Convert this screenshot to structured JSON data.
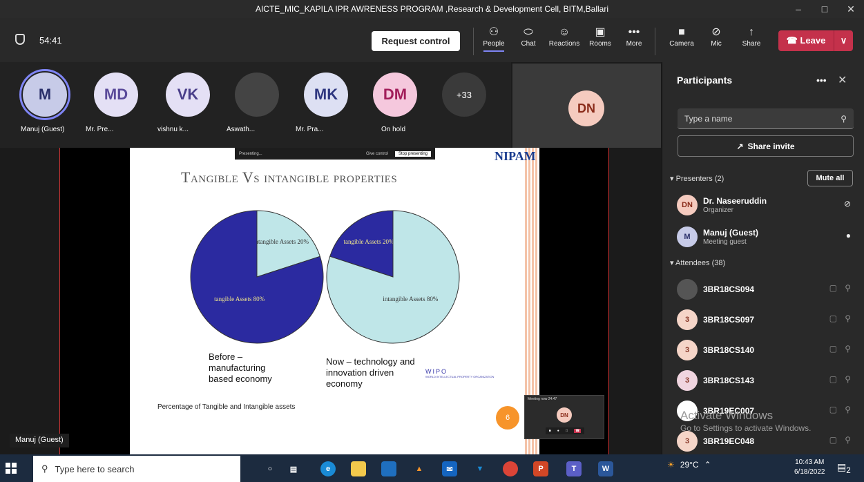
{
  "window": {
    "title": "AICTE_MIC_KAPILA IPR AWRENESS PROGRAM ,Research & Development Cell, BITM,Ballari",
    "minimize": "–",
    "maximize": "□",
    "close": "✕"
  },
  "toolbar": {
    "timer": "54:41",
    "request_control": "Request control",
    "items": [
      {
        "label": "People",
        "icon": "people-icon",
        "glyph": "⚇"
      },
      {
        "label": "Chat",
        "icon": "chat-icon",
        "glyph": "⬭"
      },
      {
        "label": "Reactions",
        "icon": "reactions-icon",
        "glyph": "☺"
      },
      {
        "label": "Rooms",
        "icon": "rooms-icon",
        "glyph": "▣"
      },
      {
        "label": "More",
        "icon": "more-icon",
        "glyph": "•••"
      },
      {
        "label": "Camera",
        "icon": "camera-off-icon",
        "glyph": "■"
      },
      {
        "label": "Mic",
        "icon": "mic-off-icon",
        "glyph": "⊘"
      },
      {
        "label": "Share",
        "icon": "share-icon",
        "glyph": "↑"
      }
    ],
    "leave": "Leave",
    "leave_icon": "☎",
    "leave_chevron": "∨"
  },
  "strip": {
    "participants": [
      {
        "initials": "M",
        "name": "Manuj (Guest)",
        "bg": "#c7cbe8",
        "fg": "#2a2f6a"
      },
      {
        "initials": "MD",
        "name": "Mr. Pre...",
        "bg": "#e4e0f5",
        "fg": "#5a4a9a"
      },
      {
        "initials": "VK",
        "name": "vishnu k...",
        "bg": "#e4e0f5",
        "fg": "#4a3f8a"
      },
      {
        "initials": "",
        "name": "Aswath...",
        "bg": "#444",
        "fg": "#fff"
      },
      {
        "initials": "MK",
        "name": "Mr. Pra...",
        "bg": "#dde0f3",
        "fg": "#2f3780"
      },
      {
        "initials": "DM",
        "name": "On hold",
        "bg": "#f5c8dd",
        "fg": "#a21d5a"
      },
      {
        "initials": "+33",
        "name": "",
        "bg": "#3a3a3a",
        "fg": "#fff"
      }
    ],
    "tile_initials": "DN"
  },
  "presenting": {
    "label": "Presenting...",
    "give_control": "Give control",
    "stop": "Stop presenting"
  },
  "slide": {
    "logo": "NIPAM",
    "title": "Tangible Vs intangible properties",
    "before": "Before – manufacturing based economy",
    "now": "Now – technology and innovation driven economy",
    "footnote": "Percentage of Tangible and Intangible assets",
    "wipo": "WIPO",
    "wipo_sub": "WORLD INTELLECTUAL PROPERTY ORGANIZATION",
    "page": "6"
  },
  "chart_data": [
    {
      "type": "pie",
      "slices": [
        {
          "label": "tangible Assets 80%",
          "value": 80,
          "color": "#2b2aa0"
        },
        {
          "label": "intangible Assets 20%",
          "value": 20,
          "color": "#bfe6e8"
        }
      ],
      "title": "",
      "caption": "Before – manufacturing based economy"
    },
    {
      "type": "pie",
      "slices": [
        {
          "label": "tangible Assets 20%",
          "value": 20,
          "color": "#2b2aa0"
        },
        {
          "label": "intangible Assets 80%",
          "value": 80,
          "color": "#bfe6e8"
        }
      ],
      "title": "",
      "caption": "Now – technology and innovation driven economy"
    }
  ],
  "mini": {
    "title": "Meeting now",
    "time": "24:47",
    "initials": "DN"
  },
  "speaker": "Manuj (Guest)",
  "panel": {
    "title": "Participants",
    "more": "•••",
    "close": "✕",
    "search_placeholder": "Type a name",
    "share_invite": "Share invite",
    "presenters_label": "Presenters (2)",
    "mute_all": "Mute all",
    "attendees_label": "Attendees (38)",
    "presenters": [
      {
        "initials": "DN",
        "name": "Dr. Naseeruddin",
        "role": "Organizer",
        "bg": "#f5cbbf",
        "fg": "#8a2c1a",
        "mic": "⊘"
      },
      {
        "initials": "M",
        "name": "Manuj (Guest)",
        "role": "Meeting guest",
        "bg": "#c7cbe8",
        "fg": "#2a2f6a",
        "mic": "●"
      }
    ],
    "attendees": [
      {
        "initials": "",
        "name": "3BR18CS094",
        "bg": "#555"
      },
      {
        "initials": "3",
        "name": "3BR18CS097",
        "bg": "#f5d5c8"
      },
      {
        "initials": "3",
        "name": "3BR18CS140",
        "bg": "#f5d5c8"
      },
      {
        "initials": "3",
        "name": "3BR18CS143",
        "bg": "#f0d5e0"
      },
      {
        "initials": "",
        "name": "3BR19EC007",
        "bg": "#fff"
      },
      {
        "initials": "3",
        "name": "3BR19EC048",
        "bg": "#f5d5c8"
      }
    ]
  },
  "watermark": {
    "line1": "Activate Windows",
    "line2": "Go to Settings to activate Windows."
  },
  "taskbar": {
    "search": "Type here to search",
    "temp": "29°C",
    "time": "10:43 AM",
    "date": "6/18/2022",
    "notif": "2"
  }
}
